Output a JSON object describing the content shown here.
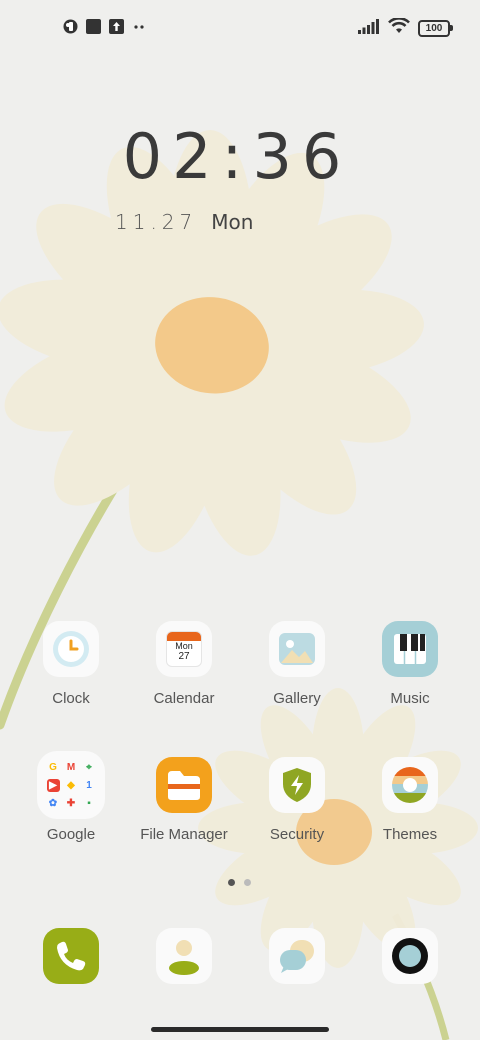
{
  "status_bar": {
    "left_icons": [
      "notification-app-icon",
      "black-square-icon",
      "upload-icon",
      "more-dots-icon"
    ],
    "battery_level": "100",
    "signal_icon": "cellular-signal-icon",
    "wifi_icon": "wifi-icon"
  },
  "lockscreen": {
    "time": "02:36",
    "date": "11.27",
    "weekday": "Mon"
  },
  "apps_row1": [
    {
      "label": "Clock",
      "icon": "clock-icon"
    },
    {
      "label": "Calendar",
      "icon": "calendar-icon",
      "icon_month_text": "Mon",
      "icon_day_text": "27"
    },
    {
      "label": "Gallery",
      "icon": "gallery-icon"
    },
    {
      "label": "Music",
      "icon": "music-icon"
    }
  ],
  "apps_row2": [
    {
      "label": "Google",
      "icon": "google-folder-icon"
    },
    {
      "label": "File Manager",
      "icon": "file-manager-icon"
    },
    {
      "label": "Security",
      "icon": "security-icon"
    },
    {
      "label": "Themes",
      "icon": "themes-icon"
    }
  ],
  "page_indicator": {
    "pages": 2,
    "active": 1
  },
  "dock": [
    {
      "icon": "phone-icon"
    },
    {
      "icon": "contacts-icon"
    },
    {
      "icon": "messages-icon"
    },
    {
      "icon": "camera-icon"
    }
  ],
  "colors": {
    "background": "#efefed",
    "petal": "#f2eddc",
    "flower_center": "#f3c98a",
    "stem": "#c6cf8a",
    "clock_accent": "#f0a020",
    "calendar_accent": "#e8661c",
    "file_manager": "#f3a11c",
    "security_green": "#8fa623",
    "phone_green": "#98ad17",
    "music_blue": "#a5cfd6"
  }
}
